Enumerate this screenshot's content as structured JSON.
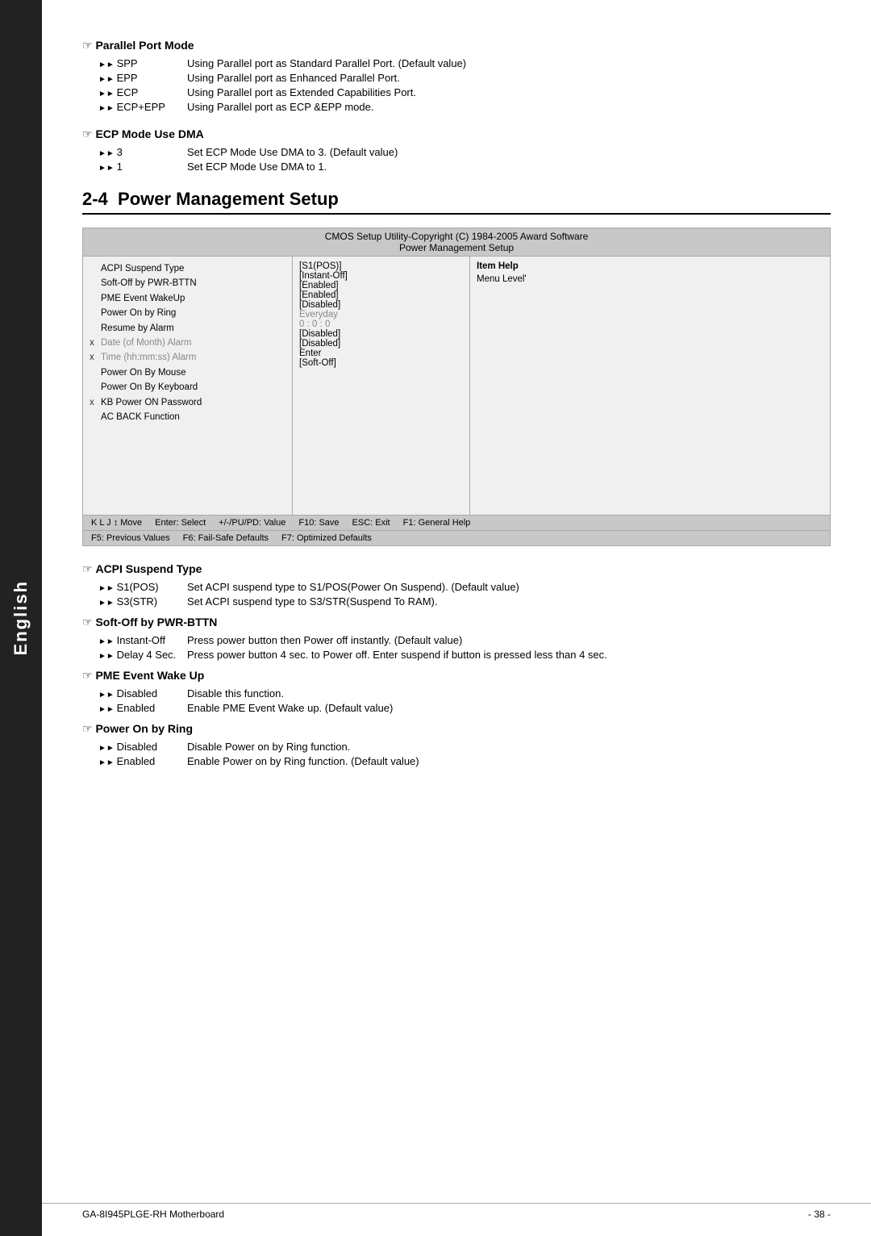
{
  "sidebar": {
    "label": "English"
  },
  "parallel_port_section": {
    "title": "Parallel Port Mode",
    "items": [
      {
        "label": "SPP",
        "desc": "Using Parallel port as Standard Parallel Port. (Default value)"
      },
      {
        "label": "EPP",
        "desc": "Using Parallel port as Enhanced Parallel Port."
      },
      {
        "label": "ECP",
        "desc": "Using Parallel port as Extended Capabilities Port."
      },
      {
        "label": "ECP+EPP",
        "desc": "Using Parallel port as ECP &EPP mode."
      }
    ]
  },
  "ecp_section": {
    "title": "ECP Mode Use DMA",
    "items": [
      {
        "label": "3",
        "desc": "Set ECP Mode Use DMA to 3. (Default value)"
      },
      {
        "label": "1",
        "desc": "Set ECP Mode Use DMA to 1."
      }
    ]
  },
  "chapter": {
    "number": "2-4",
    "title": "Power Management Setup"
  },
  "cmos": {
    "header1": "CMOS Setup Utility-Copyright (C) 1984-2005 Award Software",
    "header2": "Power Management Setup",
    "rows": [
      {
        "x": "",
        "label": "ACPI Suspend Type",
        "value": "[S1(POS)]"
      },
      {
        "x": "",
        "label": "Soft-Off by PWR-BTTN",
        "value": "[Instant-Off]"
      },
      {
        "x": "",
        "label": "PME Event WakeUp",
        "value": "[Enabled]"
      },
      {
        "x": "",
        "label": "Power On by Ring",
        "value": "[Enabled]"
      },
      {
        "x": "",
        "label": "Resume by Alarm",
        "value": "[Disabled]"
      },
      {
        "x": "x",
        "label": "Date (of Month) Alarm",
        "value": "Everyday",
        "grayed": true
      },
      {
        "x": "x",
        "label": "Time (hh:mm:ss) Alarm",
        "value": "0 : 0 : 0",
        "grayed": true
      },
      {
        "x": "",
        "label": "Power On By Mouse",
        "value": "[Disabled]"
      },
      {
        "x": "",
        "label": "Power On By Keyboard",
        "value": "[Disabled]"
      },
      {
        "x": "x",
        "label": "KB Power ON Password",
        "value": "Enter"
      },
      {
        "x": "",
        "label": "AC BACK Function",
        "value": "[Soft-Off]"
      }
    ],
    "item_help_title": "Item Help",
    "item_help_desc": "Menu Level'",
    "footer1_left": "K L J ↕ Move",
    "footer1_mid1": "Enter: Select",
    "footer1_mid2": "+/-/PU/PD: Value",
    "footer1_mid3": "F10: Save",
    "footer1_right1": "ESC: Exit",
    "footer1_right2": "F1: General Help",
    "footer2_left": "F5: Previous Values",
    "footer2_mid": "F6: Fail-Safe Defaults",
    "footer2_right": "F7: Optimized Defaults"
  },
  "acpi_section": {
    "title": "ACPI Suspend Type",
    "items": [
      {
        "label": "S1(POS)",
        "desc": "Set ACPI suspend type to S1/POS(Power On Suspend). (Default value)"
      },
      {
        "label": "S3(STR)",
        "desc": "Set ACPI suspend type to S3/STR(Suspend To RAM)."
      }
    ]
  },
  "soft_off_section": {
    "title": "Soft-Off by PWR-BTTN",
    "items": [
      {
        "label": "Instant-Off",
        "desc": "Press power button then Power off instantly. (Default value)"
      },
      {
        "label": "Delay 4 Sec.",
        "desc": "Press power button 4 sec. to Power off. Enter suspend if button is pressed less than 4 sec."
      }
    ]
  },
  "pme_section": {
    "title": "PME Event Wake Up",
    "items": [
      {
        "label": "Disabled",
        "desc": "Disable this function."
      },
      {
        "label": "Enabled",
        "desc": "Enable PME Event Wake up. (Default value)"
      }
    ]
  },
  "power_ring_section": {
    "title": "Power On by Ring",
    "items": [
      {
        "label": "Disabled",
        "desc": "Disable Power on by Ring function."
      },
      {
        "label": "Enabled",
        "desc": "Enable Power on by Ring function. (Default value)"
      }
    ]
  },
  "footer": {
    "left": "GA-8I945PLGE-RH Motherboard",
    "right": "- 38 -"
  }
}
